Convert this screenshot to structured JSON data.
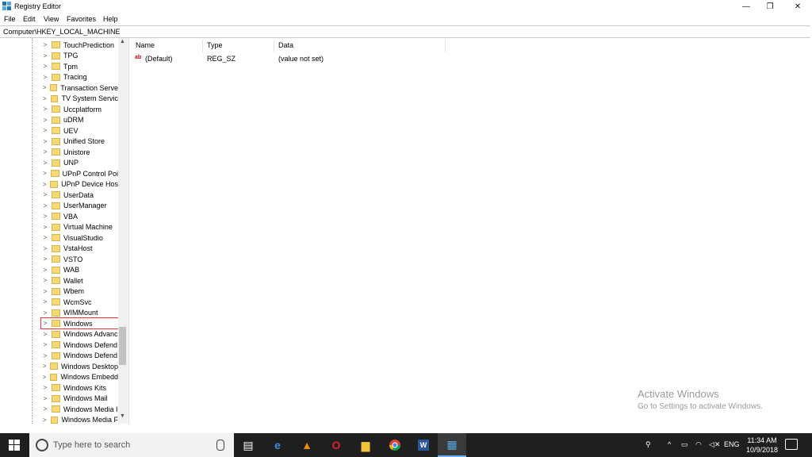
{
  "window": {
    "title": "Registry Editor",
    "minimize": "—",
    "restore": "❐",
    "close": "✕"
  },
  "menu": [
    "File",
    "Edit",
    "View",
    "Favorites",
    "Help"
  ],
  "address": "Computer\\HKEY_LOCAL_MACHINE",
  "tree": {
    "items": [
      "TouchPrediction",
      "TPG",
      "Tpm",
      "Tracing",
      "Transaction Serve",
      "TV System Servic",
      "Uccplatform",
      "uDRM",
      "UEV",
      "Unified Store",
      "Unistore",
      "UNP",
      "UPnP Control Poi",
      "UPnP Device Hos",
      "UserData",
      "UserManager",
      "VBA",
      "Virtual Machine",
      "VisualStudio",
      "VstaHost",
      "VSTO",
      "WAB",
      "Wallet",
      "Wbem",
      "WcmSvc",
      "WIMMount",
      "Windows",
      "Windows Advanc",
      "Windows Defend",
      "Windows Defend",
      "Windows Desktop",
      "Windows Embedd",
      "Windows Kits",
      "Windows Mail",
      "Windows Media I",
      "Windows Media F"
    ],
    "selected": "Windows",
    "arrow": ">"
  },
  "list": {
    "columns": [
      "Name",
      "Type",
      "Data"
    ],
    "rows": [
      {
        "name": "(Default)",
        "type": "REG_SZ",
        "data": "(value not set)"
      }
    ]
  },
  "watermark": {
    "title": "Activate Windows",
    "subtitle": "Go to Settings to activate Windows."
  },
  "taskbar": {
    "search_placeholder": "Type here to search",
    "language": "ENG",
    "time": "11:34 AM",
    "date": "10/9/2018",
    "accent": "#6aaef5"
  }
}
